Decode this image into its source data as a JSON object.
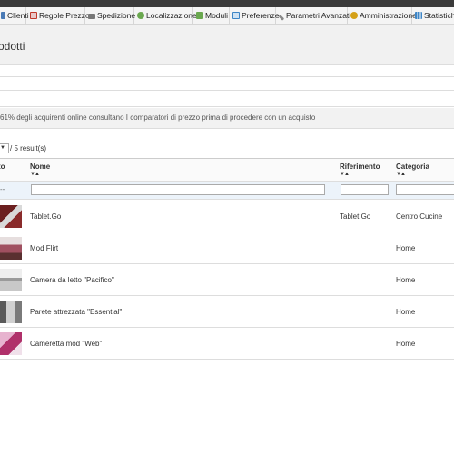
{
  "nav_tabs": [
    {
      "label": "Clienti",
      "icon": "users-icon",
      "color": "#4a7ab5"
    },
    {
      "label": "Regole Prezzo",
      "icon": "price-rules-icon",
      "color": "#c0392b"
    },
    {
      "label": "Spedizione",
      "icon": "truck-icon",
      "color": "#555555"
    },
    {
      "label": "Localizzazione",
      "icon": "globe-icon",
      "color": "#6aa84f"
    },
    {
      "label": "Moduli",
      "icon": "puzzle-icon",
      "color": "#6aa84f"
    },
    {
      "label": "Preferenze",
      "icon": "preferences-icon",
      "color": "#3d85c6"
    },
    {
      "label": "Parametri Avanzati",
      "icon": "wrench-icon",
      "color": "#666666"
    },
    {
      "label": "Amministrazione",
      "icon": "key-icon",
      "color": "#d4a017"
    },
    {
      "label": "Statistiche",
      "icon": "chart-icon",
      "color": "#3d85c6"
    }
  ],
  "page": {
    "title": "odotti",
    "info_message": "61% degli acquirenti online consultano I comparatori di prezzo prima di procedere con un acquisto"
  },
  "pager": {
    "select_arrow": "▼",
    "result_text": "/ 5 result(s)"
  },
  "table": {
    "columns": [
      {
        "label": "to",
        "sort": ""
      },
      {
        "label": "Nome",
        "sort": "▼▲"
      },
      {
        "label": "Riferimento",
        "sort": "▼▲"
      },
      {
        "label": "Categoria",
        "sort": "▼▲"
      }
    ],
    "filter_dash": "--",
    "rows": [
      {
        "nome": "Tablet.Go",
        "riferimento": "Tablet.Go",
        "categoria": "Centro Cucine",
        "thumb_color": "#8a2b2b"
      },
      {
        "nome": "Mod Flirt",
        "riferimento": "",
        "categoria": "Home",
        "thumb_color": "#a05060"
      },
      {
        "nome": "Camera da letto \"Pacifico\"",
        "riferimento": "",
        "categoria": "Home",
        "thumb_color": "#c8c8c8"
      },
      {
        "nome": "Parete attrezzata \"Essential\"",
        "riferimento": "",
        "categoria": "Home",
        "thumb_color": "#7a7a7a"
      },
      {
        "nome": "Cameretta mod \"Web\"",
        "riferimento": "",
        "categoria": "Home",
        "thumb_color": "#b0306a"
      }
    ]
  }
}
